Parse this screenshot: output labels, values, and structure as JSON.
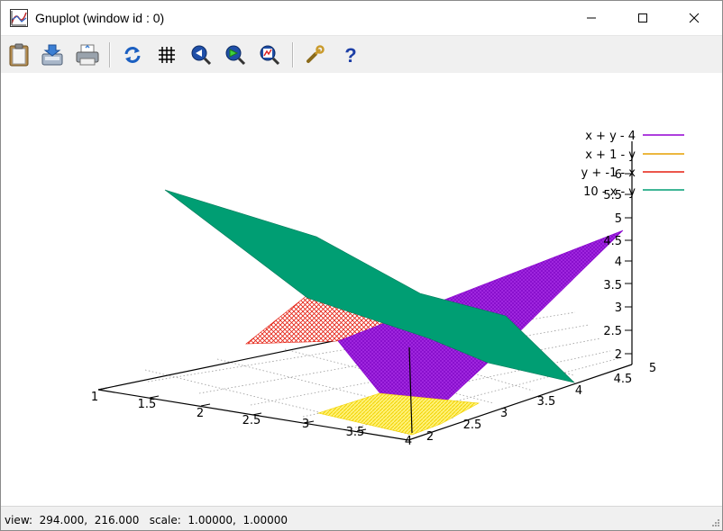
{
  "window": {
    "title": "Gnuplot (window id : 0)"
  },
  "titlebar_buttons": [
    {
      "name": "minimize-button",
      "icon": "minimize-icon"
    },
    {
      "name": "maximize-button",
      "icon": "maximize-icon"
    },
    {
      "name": "close-button",
      "icon": "close-icon"
    }
  ],
  "toolbar": {
    "buttons": [
      {
        "name": "copy-clipboard",
        "icon": "clipboard-icon"
      },
      {
        "name": "save",
        "icon": "save-icon"
      },
      {
        "name": "print",
        "icon": "printer-icon"
      },
      {
        "name": "replot",
        "icon": "refresh-icon"
      },
      {
        "name": "grid",
        "icon": "grid-icon"
      },
      {
        "name": "previous-zoom",
        "icon": "zoom-back-icon"
      },
      {
        "name": "next-zoom",
        "icon": "zoom-forward-icon"
      },
      {
        "name": "autoscale",
        "icon": "zoom-fit-icon"
      },
      {
        "name": "options",
        "icon": "wrench-icon"
      },
      {
        "name": "help",
        "icon": "help-icon"
      }
    ]
  },
  "plot": {
    "legend": [
      {
        "label": "x + y - 4",
        "color": "#9400d3"
      },
      {
        "label": "x + 1 - y",
        "color": "#e69f00"
      },
      {
        "label": "y + -1 - x",
        "color": "#e51e10"
      },
      {
        "label": "10 - x - y",
        "color": "#009e73"
      }
    ],
    "x_ticks": [
      "1",
      "1.5",
      "2",
      "2.5",
      "3",
      "3.5",
      "4"
    ],
    "y_ticks": [
      "2",
      "2.5",
      "3",
      "3.5",
      "4",
      "4.5",
      "5"
    ],
    "z_ticks": [
      "2",
      "2.5",
      "3",
      "3.5",
      "4",
      "4.5",
      "5",
      "5.5",
      "6"
    ],
    "colors": {
      "surface_1": "#9400d3",
      "surface_2": "#e69f00",
      "surface_3": "#e51e10",
      "surface_4": "#009e73"
    }
  },
  "status": {
    "text": "view:  294.000,  216.000   scale:  1.00000,  1.00000"
  }
}
